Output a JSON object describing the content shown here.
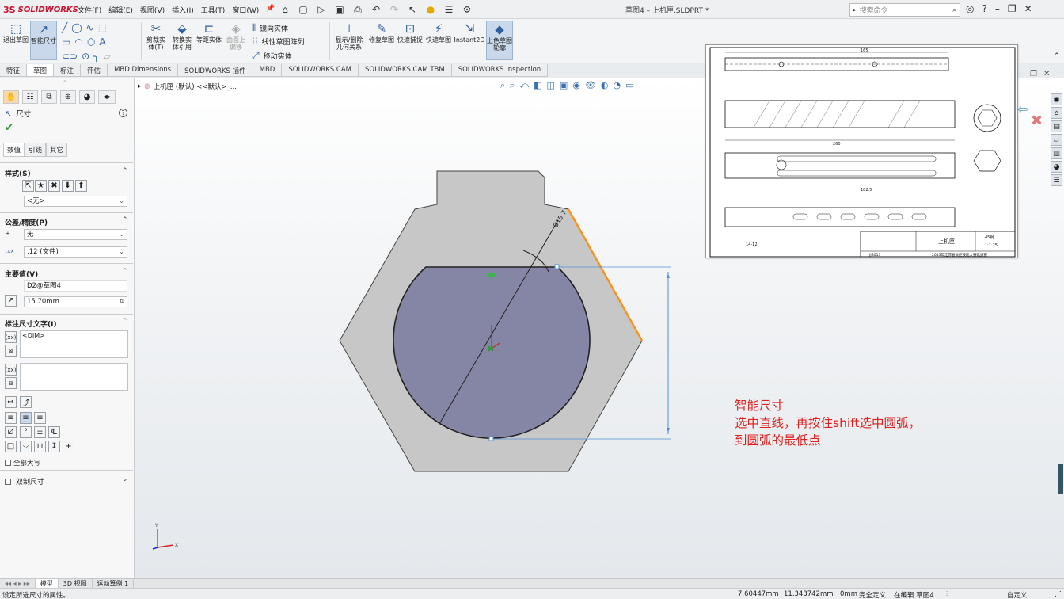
{
  "app": {
    "logo_ds": "3S",
    "logo_text": "SOLIDWORKS",
    "window_title": "草图4 – 上机匣.SLDPRT *",
    "menus": [
      "文件(F)",
      "编辑(E)",
      "视图(V)",
      "插入(I)",
      "工具(T)",
      "窗口(W)"
    ],
    "search_placeholder": "搜索命令"
  },
  "commands": {
    "exit_sketch": "退出草图",
    "smart_dim": "智能尺寸",
    "trim": "剪裁实体(T)",
    "convert": "转换实体引用",
    "offset": "等距实体",
    "surface_offset": "曲面上偏移",
    "mirror": "镜向实体",
    "linear_pattern": "线性草图阵列",
    "move": "移动实体",
    "show_relations": "显示/删除几何关系",
    "repair": "修复草图",
    "quick_snap": "快速捕捉",
    "rapid_sketch": "快速草图",
    "instant2d": "Instant2D",
    "shaded_sketch": "上色草图轮廓"
  },
  "tabs": [
    "特征",
    "草图",
    "标注",
    "评估",
    "MBD Dimensions",
    "SOLIDWORKS 插件",
    "MBD",
    "SOLIDWORKS CAM",
    "SOLIDWORKS CAM TBM",
    "SOLIDWORKS Inspection"
  ],
  "active_tab": "草图",
  "pm": {
    "title": "尺寸",
    "subtabs": [
      "数值",
      "引线",
      "其它"
    ],
    "style_section": "样式(S)",
    "style_value": "<无>",
    "tolerance_section": "公差/精度(P)",
    "tolerance_value": "无",
    "precision_value": ".12 (文件)",
    "primary_section": "主要值(V)",
    "primary_name": "D2@草图4",
    "primary_value": "15.70mm",
    "dimtext_section": "标注尺寸文字(I)",
    "dimtext_value": "<DIM>",
    "all_caps": "全部大写",
    "dual_dim": "双制尺寸"
  },
  "breadcrumb": "上机匣 (默认) <<默认>_...",
  "dimension_label": "Ø15.7",
  "annotation": {
    "line1": "智能尺寸",
    "line2": "选中直线，再按住shift选中圆弧，",
    "line3": "到圆弧的最低点"
  },
  "drawing": {
    "title": "上机匣",
    "material": "45钢",
    "scale": "1:1.25",
    "footer": "2013年江苏省数控技能大赛选拔赛",
    "code": "JJB013",
    "dim_top": "165",
    "dim_mid": "260",
    "dim_bottom": "182.5",
    "tolerance_note": "14-12"
  },
  "bottom_tabs": [
    "模型",
    "3D 视图",
    "运动算例 1"
  ],
  "status": {
    "hint": "设定所选尺寸的属性。",
    "x": "7.60447mm",
    "y": "11.343742mm",
    "z": "0mm",
    "state": "完全定义",
    "editing": "在编辑 草图4",
    "units": "自定义"
  },
  "colors": {
    "part_fill": "#c7c7c7",
    "circle_fill": "#8585a5",
    "highlight": "#f7941d",
    "annotation": "#e0201f",
    "dim_line": "#4f8fd6"
  }
}
